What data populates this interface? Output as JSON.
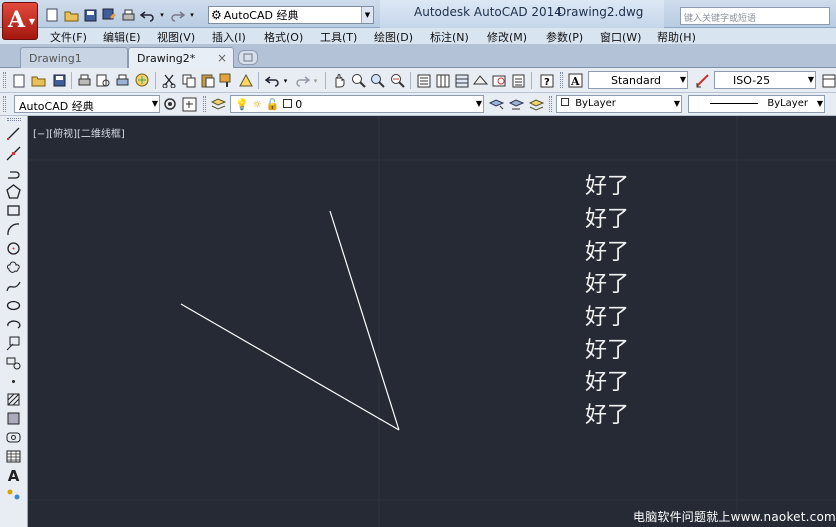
{
  "app": {
    "title": "Autodesk AutoCAD 2014",
    "document": "Drawing2.dwg",
    "workspace": "AutoCAD 经典",
    "search_placeholder": "键入关键字或短语"
  },
  "menu": [
    "文件(F)",
    "编辑(E)",
    "视图(V)",
    "插入(I)",
    "格式(O)",
    "工具(T)",
    "绘图(D)",
    "标注(N)",
    "修改(M)",
    "参数(P)",
    "窗口(W)",
    "帮助(H)"
  ],
  "tabs": [
    {
      "label": "Drawing1",
      "active": false
    },
    {
      "label": "Drawing2*",
      "active": true
    }
  ],
  "toolbar1": {
    "text_style": "Standard",
    "dim_style": "ISO-25"
  },
  "toolbar2": {
    "workspace": "AutoCAD 经典",
    "layer": "0",
    "color": "ByLayer",
    "linetype": "ByLayer"
  },
  "viewport": {
    "label": "[−][俯视][二维线框]"
  },
  "drawing": {
    "texts": [
      "好了",
      "好了",
      "好了",
      "好了",
      "好了",
      "好了",
      "好了",
      "好了"
    ],
    "line_color": "#ffffff"
  },
  "watermark": "电脑软件问题就上www.naoket.com",
  "colors": {
    "canvas": "#252a34",
    "accent": "#c0261b",
    "grid": "#2e3440"
  }
}
